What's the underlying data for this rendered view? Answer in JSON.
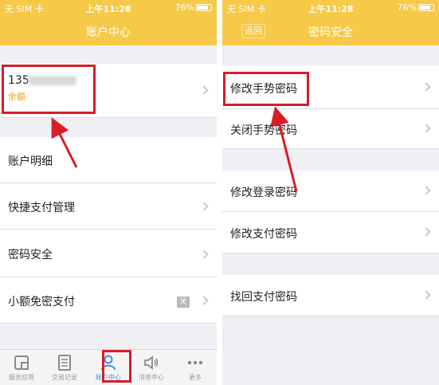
{
  "left": {
    "status": {
      "carrier": "无 SIM 卡",
      "time": "上午11:28",
      "battery": "76%"
    },
    "nav_title": "账户中心",
    "account": {
      "number": "135",
      "balance_label": "余额"
    },
    "rows": [
      "账户明细",
      "快捷支付管理",
      "密码安全",
      "小额免密支付"
    ],
    "tag": "关",
    "tabs": [
      {
        "label": "服务应用",
        "icon": "apps-icon"
      },
      {
        "label": "交易记录",
        "icon": "records-icon"
      },
      {
        "label": "账户中心",
        "icon": "user-icon"
      },
      {
        "label": "消息中心",
        "icon": "speaker-icon"
      },
      {
        "label": "更多",
        "icon": "more-icon"
      }
    ]
  },
  "right": {
    "status": {
      "carrier": "无 SIM 卡",
      "time": "上午11:28",
      "battery": "76%"
    },
    "nav_title": "密码安全",
    "back_label": "返回",
    "rows": [
      "修改手势密码",
      "关闭手势密码",
      "修改登录密码",
      "修改支付密码",
      "找回支付密码"
    ]
  },
  "colors": {
    "brand_yellow": "#f7c948",
    "highlight_red": "#d71c2a",
    "active_blue": "#3a8ee6"
  }
}
